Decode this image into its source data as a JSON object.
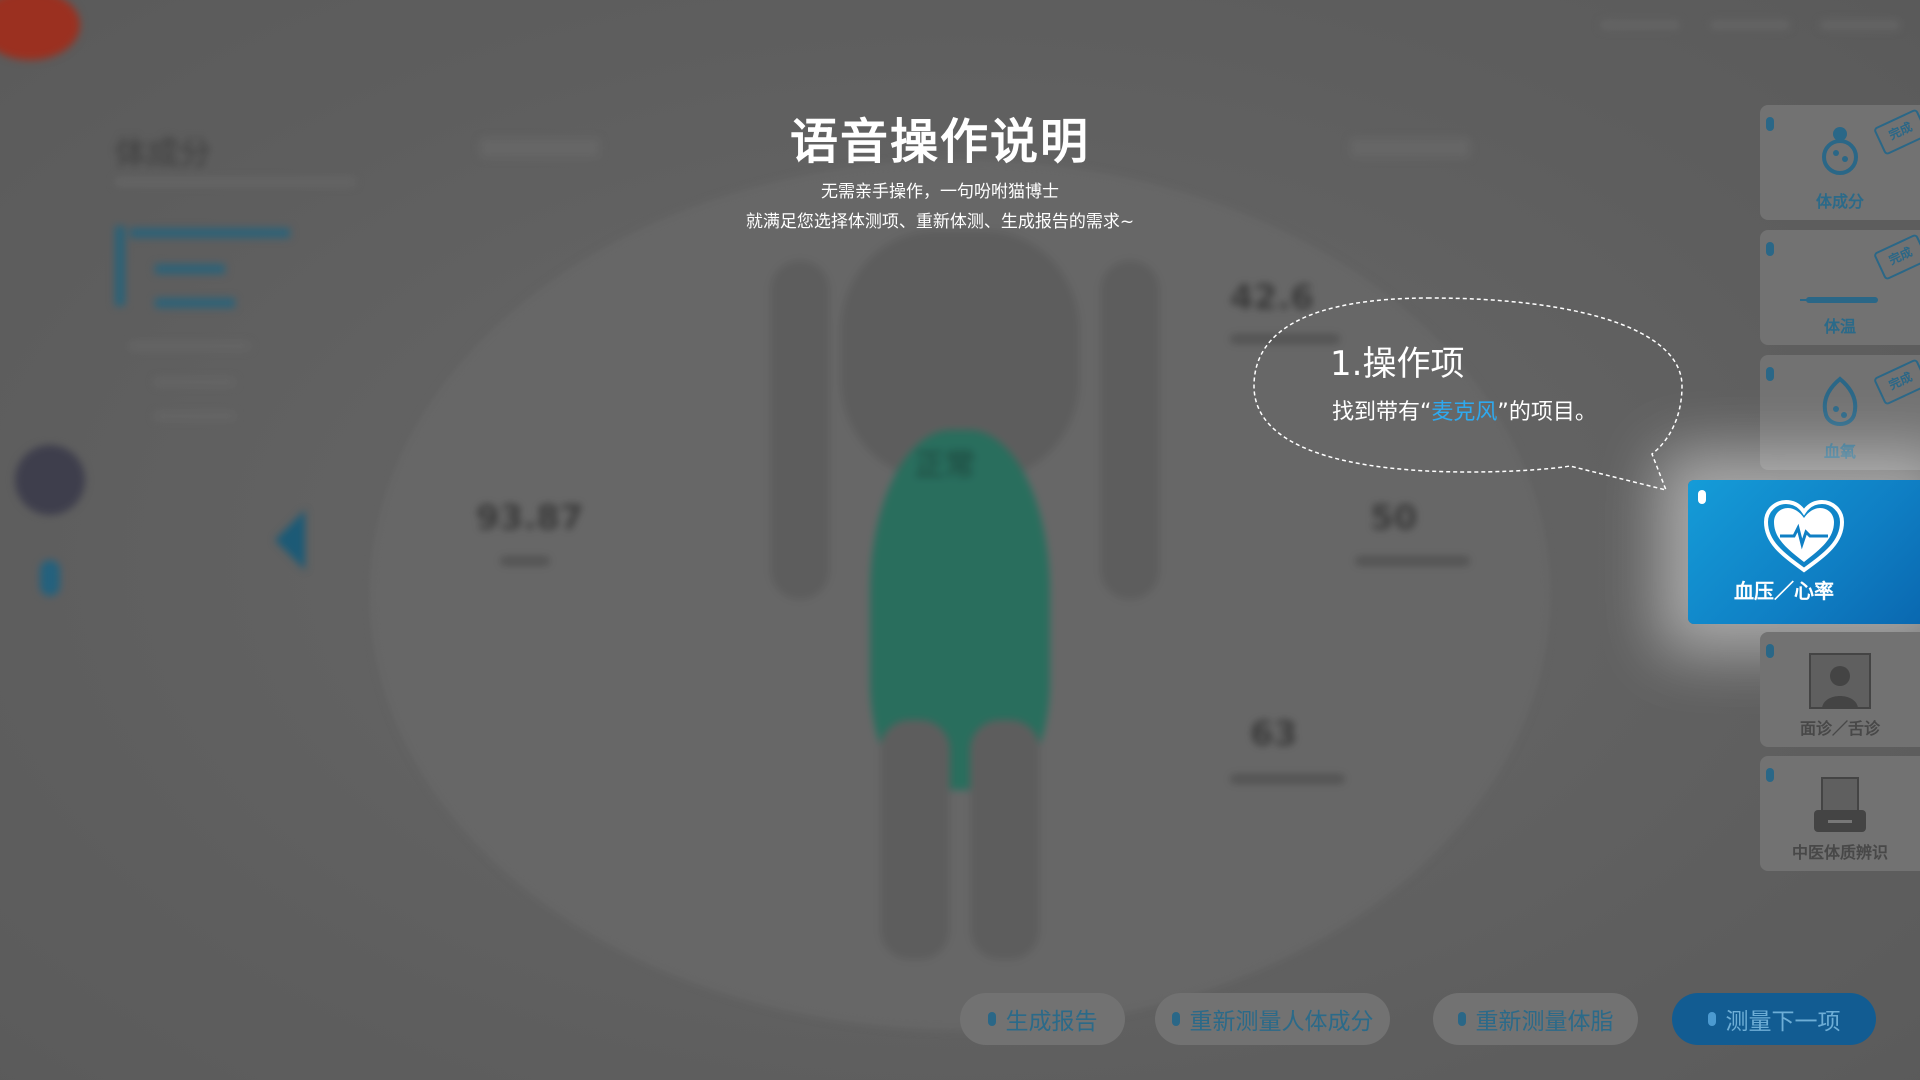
{
  "overlay": {
    "title": "语音操作说明",
    "line1": "无需亲手操作，一句吩咐猫博士",
    "line2": "就满足您选择体测项、重新体测、生成报告的需求~"
  },
  "bubble": {
    "heading": "1.操作项",
    "text_before": "找到带有“",
    "highlight": "麦克风",
    "text_after": "”的项目。"
  },
  "background": {
    "left_title": "体成分",
    "stat_left": "93.87",
    "stat_right_top": "42.6",
    "stat_right_mid": "50",
    "stat_right_bottom": "63",
    "figure_label": "正常"
  },
  "sidebar": {
    "items": [
      {
        "label": "体成分",
        "icon": "body-composition-icon",
        "stamp": "完成"
      },
      {
        "label": "体温",
        "icon": "thermometer-icon",
        "stamp": "完成"
      },
      {
        "label": "血氧",
        "icon": "blood-oxygen-icon",
        "stamp": "完成"
      },
      {
        "label": "血压／心率",
        "icon": "heart-pulse-icon",
        "active": true
      },
      {
        "label": "面诊／舌诊",
        "icon": "face-scan-icon"
      },
      {
        "label": "中医体质辨识",
        "icon": "tcm-printer-icon"
      }
    ]
  },
  "buttons": {
    "report": "生成报告",
    "remeasure_body": "重新测量人体成分",
    "remeasure_fat": "重新测量体脂",
    "next": "测量下一项"
  },
  "colors": {
    "accent": "#12a0dc",
    "highlight": "#2ea9ef",
    "primary_btn": "#125c92"
  }
}
